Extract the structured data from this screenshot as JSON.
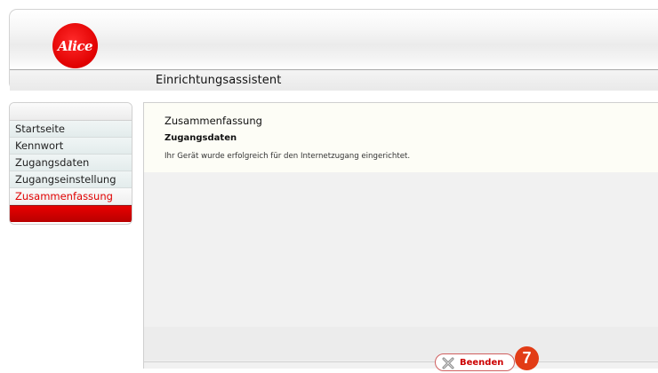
{
  "header": {
    "logo_text": "Alice",
    "title": "Einrichtungsassistent"
  },
  "sidebar": {
    "items": [
      {
        "label": "Startseite",
        "active": false
      },
      {
        "label": "Kennwort",
        "active": false
      },
      {
        "label": "Zugangsdaten",
        "active": false
      },
      {
        "label": "Zugangseinstellung",
        "active": false
      },
      {
        "label": "Zusammenfassung",
        "active": true
      }
    ]
  },
  "main": {
    "section_title": "Zusammenfassung",
    "subsection_title": "Zugangsdaten",
    "message": "Ihr Gerät wurde erfolgreich für den Internetzugang eingerichtet."
  },
  "footer": {
    "finish_label": "Beenden",
    "finish_icon": "close-icon"
  },
  "annotation": {
    "step_number": "7",
    "color": "#e23c16"
  },
  "colors": {
    "brand_red": "#e00000",
    "active_nav": "#e00000"
  }
}
